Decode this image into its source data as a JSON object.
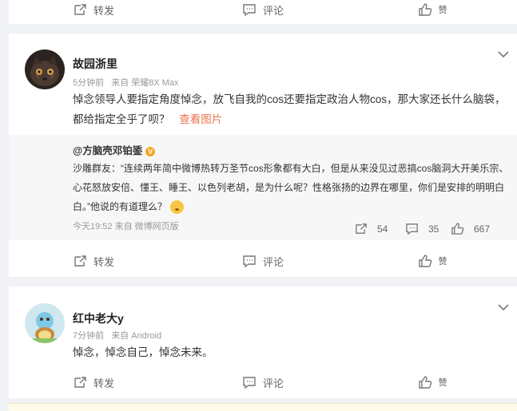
{
  "actions": {
    "repost_label": "转发",
    "comment_label": "评论",
    "like_label": "赞"
  },
  "post1": {
    "username": "故园浙里",
    "time": "5分钟前",
    "source": "来自 荣耀8X Max",
    "text": "悼念领导人要指定角度悼念，放飞自我的cos还要指定政治人物cos，那大家还长什么脑袋，都给指定全乎了呗？",
    "view_image": "查看图片",
    "quote": {
      "author": "@方脑壳邓铂鋈",
      "badge": "V",
      "text": "沙雕群友：“连续两年简中微博热转万圣节cos形象都有大白，但是从来没见过恶搞cos脑洞大开美乐宗、心花怒放安倍、懂王、睡王、以色列老胡，是为什么呢？性格张扬的边界在哪里，你们是安排的明明白白。”他说的有道理么？",
      "meta": "今天19:52 来自 微博网页版",
      "reposts": "54",
      "comments": "35",
      "likes": "667"
    }
  },
  "post2": {
    "username": "红中老大y",
    "time": "7分钟前",
    "source": "来自 Android",
    "text": "悼念，悼念自己，悼念未来。"
  }
}
